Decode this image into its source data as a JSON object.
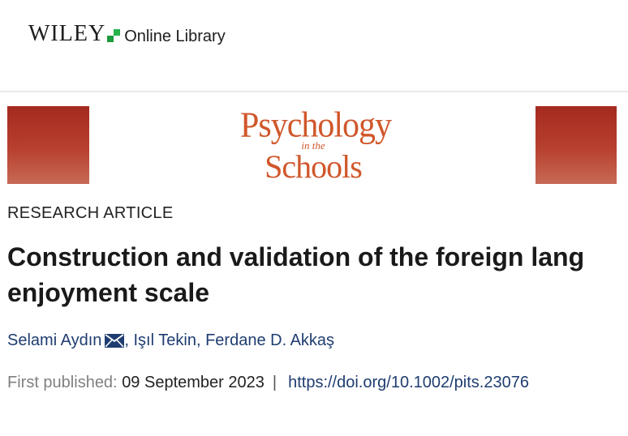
{
  "header": {
    "brand_word": "WILEY",
    "brand_suffix": "Online Library"
  },
  "journal": {
    "logo_line1": "Psychology",
    "logo_line2": "in the",
    "logo_line3": "Schools"
  },
  "article": {
    "type": "RESEARCH ARTICLE",
    "title_line1": "Construction and validation of the foreign lang",
    "title_line2": "enjoyment scale",
    "authors": [
      {
        "name": "Selami Aydın"
      },
      {
        "name": "Işıl Tekin"
      },
      {
        "name": "Ferdane D. Akkaş"
      }
    ],
    "first_published_label": "First published:",
    "first_published_date": "09 September 2023",
    "separator": "|",
    "doi": "https://doi.org/10.1002/pits.23076"
  },
  "colors": {
    "brand_green": "#1c9a3d",
    "journal_orange": "#d0572b",
    "banner_red": "#a42a1f",
    "link_blue": "#1f3d70"
  },
  "icons": {
    "author_contact": "mail-icon"
  }
}
